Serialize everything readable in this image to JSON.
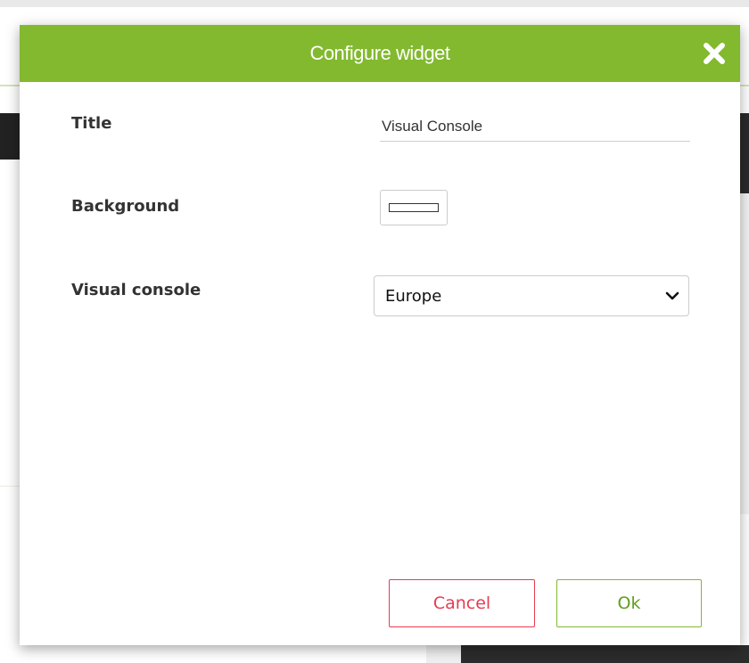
{
  "dialog": {
    "title": "Configure widget",
    "header_color": "#82b92e",
    "close_icon": "close-icon"
  },
  "form": {
    "title_label": "Title",
    "title_value": "Visual Console",
    "background_label": "Background",
    "background_color": "#ffffff",
    "visual_console_label": "Visual console",
    "visual_console_selected": "Europe"
  },
  "buttons": {
    "cancel_label": "Cancel",
    "ok_label": "Ok"
  },
  "colors": {
    "accent_green": "#82b92e",
    "cancel_red": "#e63c52"
  }
}
